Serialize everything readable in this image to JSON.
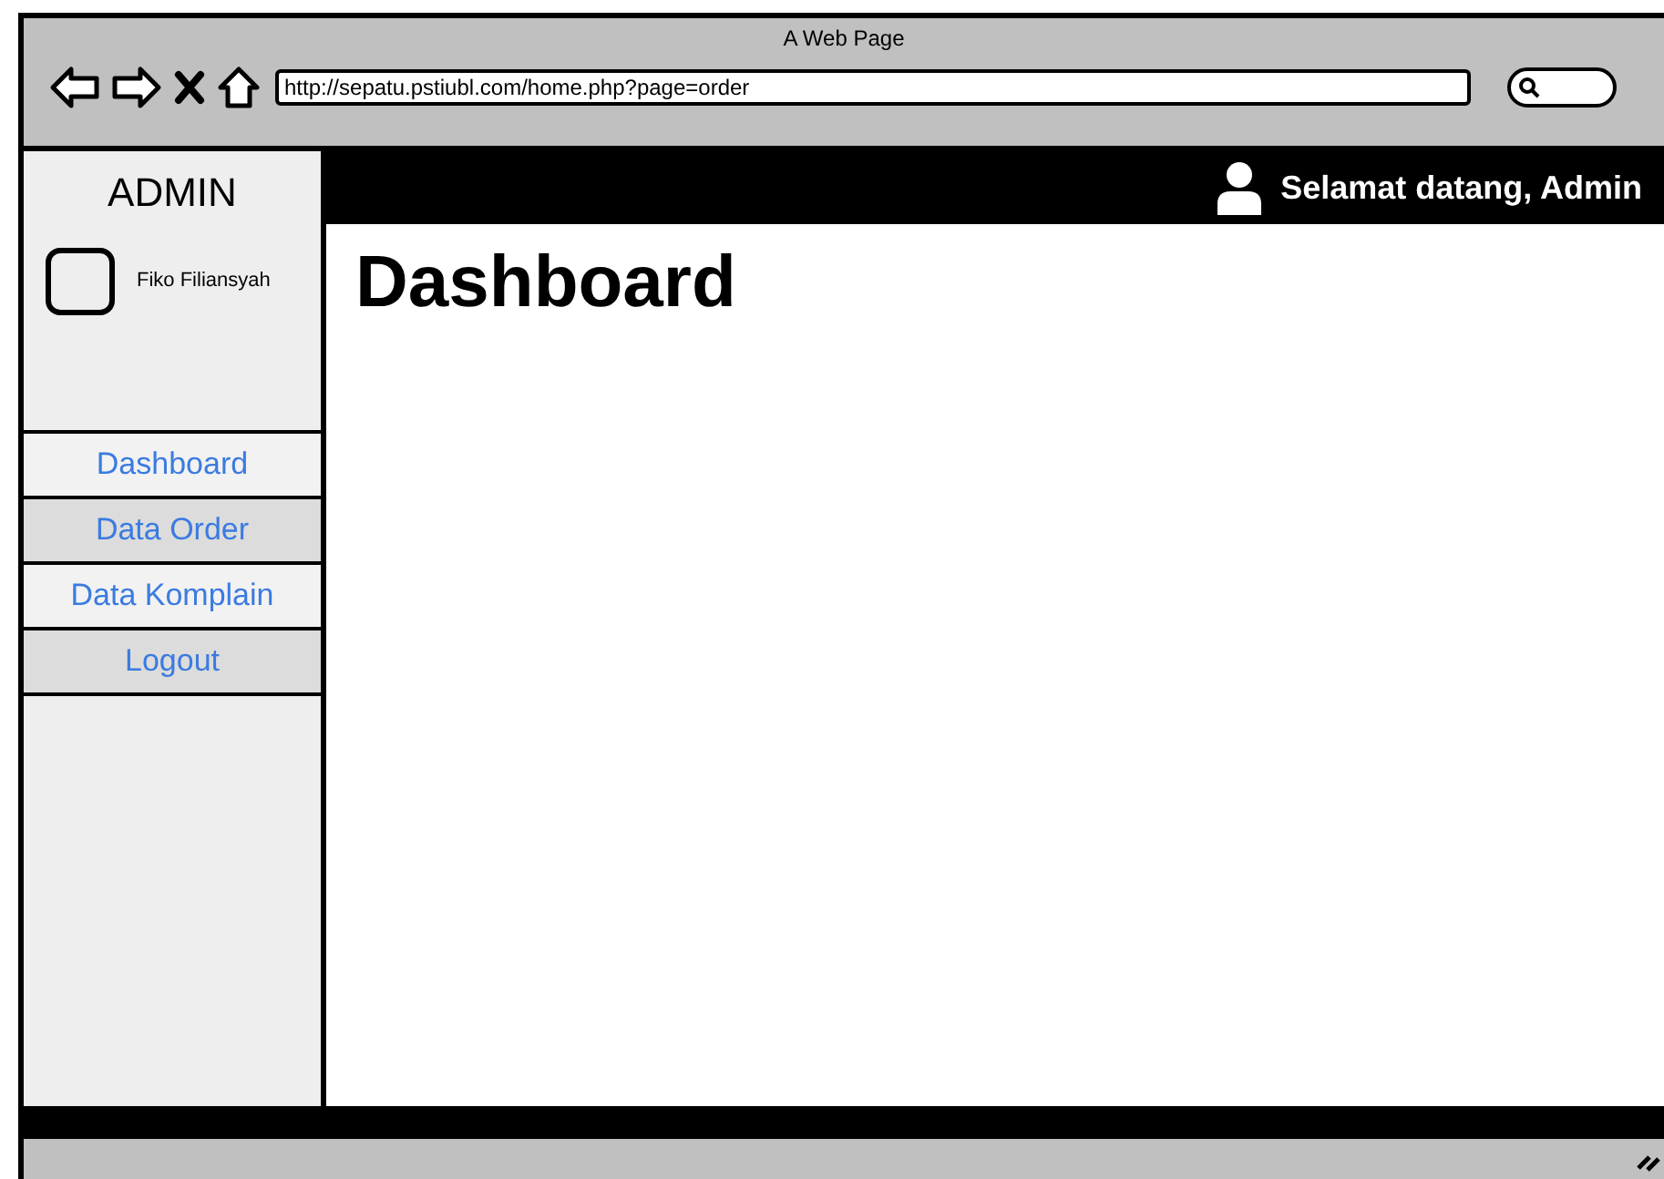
{
  "window": {
    "title": "A Web Page"
  },
  "address_bar": {
    "value": "http://sepatu.pstiubl.com/home.php?page=order"
  },
  "sidebar": {
    "title": "ADMIN",
    "user_name": "Fiko Filiansyah",
    "items": [
      {
        "label": "Dashboard",
        "highlighted": false
      },
      {
        "label": "Data Order",
        "highlighted": true
      },
      {
        "label": "Data Komplain",
        "highlighted": false
      },
      {
        "label": "Logout",
        "highlighted": true
      }
    ]
  },
  "header": {
    "greeting": "Selamat datang, Admin"
  },
  "content": {
    "heading": "Dashboard"
  }
}
